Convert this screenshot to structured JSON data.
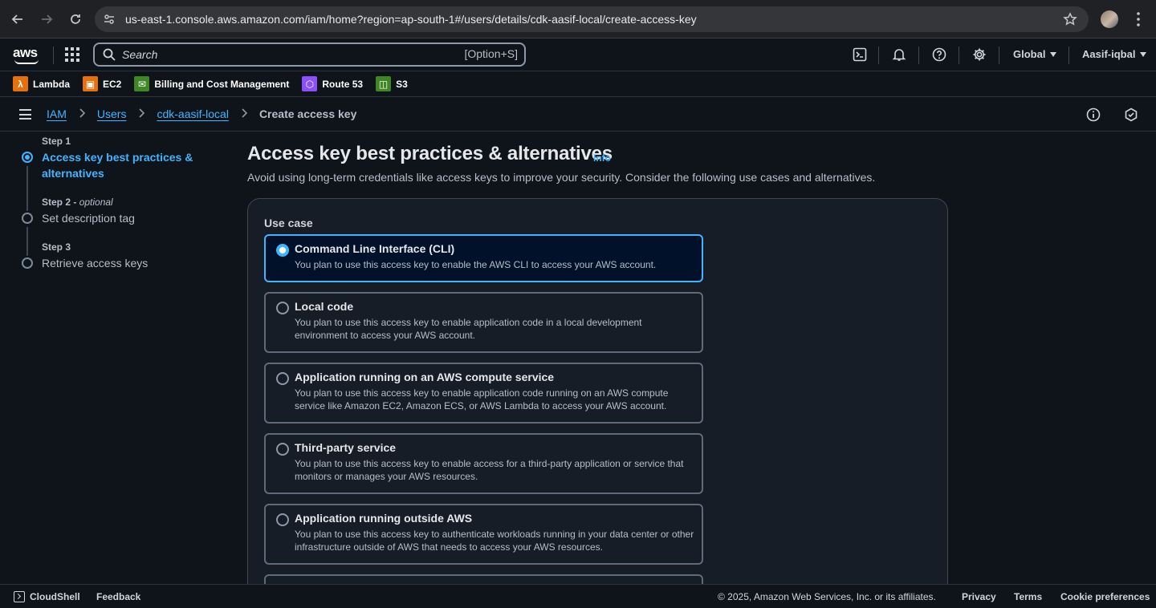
{
  "browser": {
    "url": "us-east-1.console.aws.amazon.com/iam/home?region=ap-south-1#/users/details/cdk-aasif-local/create-access-key"
  },
  "topnav": {
    "logo": "aws",
    "search_placeholder": "Search",
    "search_shortcut": "[Option+S]",
    "region": "Global",
    "user": "Aasif-iqbal",
    "icons": [
      "cloudshell-icon",
      "bell-icon",
      "help-icon",
      "gear-icon"
    ]
  },
  "favorites": [
    {
      "label": "Lambda",
      "color": "#e7700d",
      "glyph": "λ"
    },
    {
      "label": "EC2",
      "color": "#e7700d",
      "glyph": "▣"
    },
    {
      "label": "Billing and Cost Management",
      "color": "#3f8624",
      "glyph": "✉"
    },
    {
      "label": "Route 53",
      "color": "#8c4fff",
      "glyph": "⬡"
    },
    {
      "label": "S3",
      "color": "#3f8624",
      "glyph": "◫"
    }
  ],
  "breadcrumb": {
    "items": [
      "IAM",
      "Users",
      "cdk-aasif-local"
    ],
    "current": "Create access key"
  },
  "steps": [
    {
      "label": "Step 1",
      "title": "Access key best practices & alternatives",
      "active": true
    },
    {
      "label": "Step 2",
      "optional": "optional",
      "title": "Set description tag",
      "active": false
    },
    {
      "label": "Step 3",
      "title": "Retrieve access keys",
      "active": false
    }
  ],
  "main": {
    "title": "Access key best practices & alternatives",
    "info": "Info",
    "description": "Avoid using long-term credentials like access keys to improve your security. Consider the following use cases and alternatives.",
    "use_case_label": "Use case",
    "options": [
      {
        "title": "Command Line Interface (CLI)",
        "desc": "You plan to use this access key to enable the AWS CLI to access your AWS account.",
        "selected": true
      },
      {
        "title": "Local code",
        "desc": "You plan to use this access key to enable application code in a local development environment to access your AWS account.",
        "selected": false
      },
      {
        "title": "Application running on an AWS compute service",
        "desc": "You plan to use this access key to enable application code running on an AWS compute service like Amazon EC2, Amazon ECS, or AWS Lambda to access your AWS account.",
        "selected": false
      },
      {
        "title": "Third-party service",
        "desc": "You plan to use this access key to enable access for a third-party application or service that monitors or manages your AWS resources.",
        "selected": false
      },
      {
        "title": "Application running outside AWS",
        "desc": "You plan to use this access key to authenticate workloads running in your data center or other infrastructure outside of AWS that needs to access your AWS resources.",
        "selected": false
      }
    ]
  },
  "footer": {
    "cloudshell": "CloudShell",
    "feedback": "Feedback",
    "copyright": "© 2025, Amazon Web Services, Inc. or its affiliates.",
    "privacy": "Privacy",
    "terms": "Terms",
    "cookies": "Cookie preferences"
  }
}
